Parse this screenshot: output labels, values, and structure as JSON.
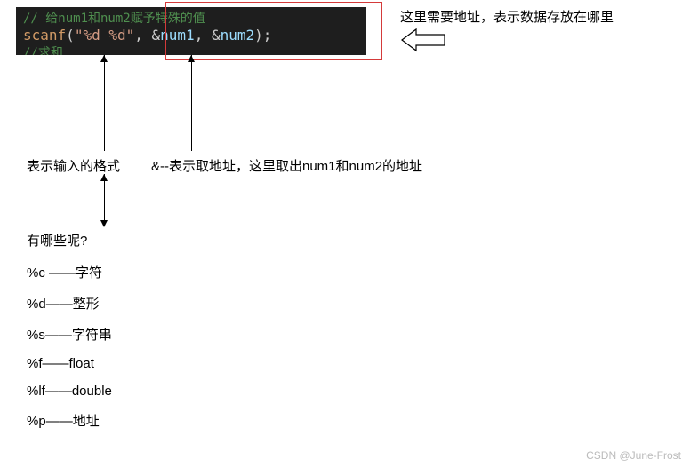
{
  "code": {
    "func": "scanf",
    "open": "(",
    "fmt": "\"%d %d\"",
    "comma1": ", ",
    "amp1": "&",
    "arg1": "num1",
    "comma2": ", ",
    "amp2": "&",
    "arg2": "num2",
    "close": ")",
    "semi": ";"
  },
  "annotations": {
    "top_note": "这里需要地址，表示数据存放在哪里",
    "format_label": "表示输入的格式",
    "addr_label": "&--表示取地址，这里取出num1和num2的地址",
    "question": "有哪些呢?"
  },
  "format_specs": [
    {
      "spec": "%c",
      "dash": " ——",
      "desc": "字符"
    },
    {
      "spec": "%d",
      "dash": "——",
      "desc": "整形"
    },
    {
      "spec": "%s",
      "dash": "——",
      "desc": "字符串"
    },
    {
      "spec": "%f",
      "dash": "——",
      "desc": "float"
    },
    {
      "spec": "%lf",
      "dash": "——",
      "desc": "double"
    },
    {
      "spec": "%p",
      "dash": "——",
      "desc": "地址"
    }
  ],
  "watermark": "CSDN @June-Frost"
}
